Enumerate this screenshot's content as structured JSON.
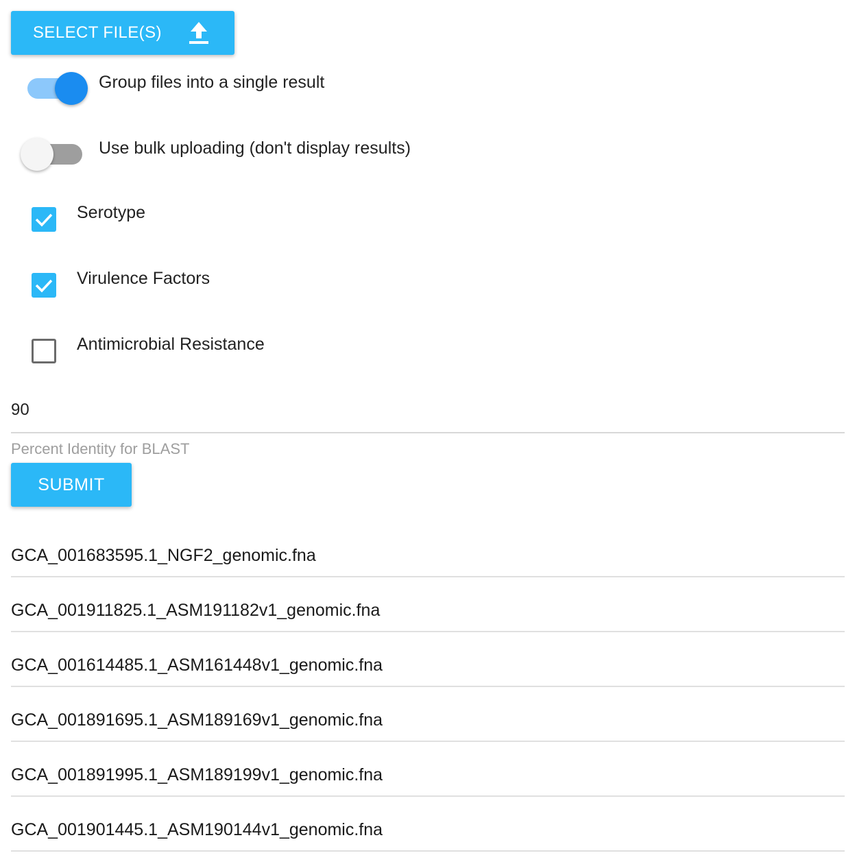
{
  "upload": {
    "button_label": "SELECT FILE(S)",
    "icon": "upload-icon"
  },
  "options": {
    "group_toggle": {
      "label": "Group files into a single result",
      "on": true
    },
    "bulk_toggle": {
      "label": "Use bulk uploading (don't display results)",
      "on": false
    }
  },
  "analyses": [
    {
      "label": "Serotype",
      "checked": true
    },
    {
      "label": "Virulence Factors",
      "checked": true
    },
    {
      "label": "Antimicrobial Resistance",
      "checked": false
    }
  ],
  "percent_identity": {
    "value": "90",
    "hint": "Percent Identity for BLAST"
  },
  "submit_label": "SUBMIT",
  "files": [
    "GCA_001683595.1_NGF2_genomic.fna",
    "GCA_001911825.1_ASM191182v1_genomic.fna",
    "GCA_001614485.1_ASM161448v1_genomic.fna",
    "GCA_001891695.1_ASM189169v1_genomic.fna",
    "GCA_001891995.1_ASM189199v1_genomic.fna",
    "GCA_001901445.1_ASM190144v1_genomic.fna"
  ],
  "colors": {
    "accent": "#2bb8f7",
    "toggle_on": "#1a8cf0",
    "toggle_track_on": "#8cc8fb"
  }
}
